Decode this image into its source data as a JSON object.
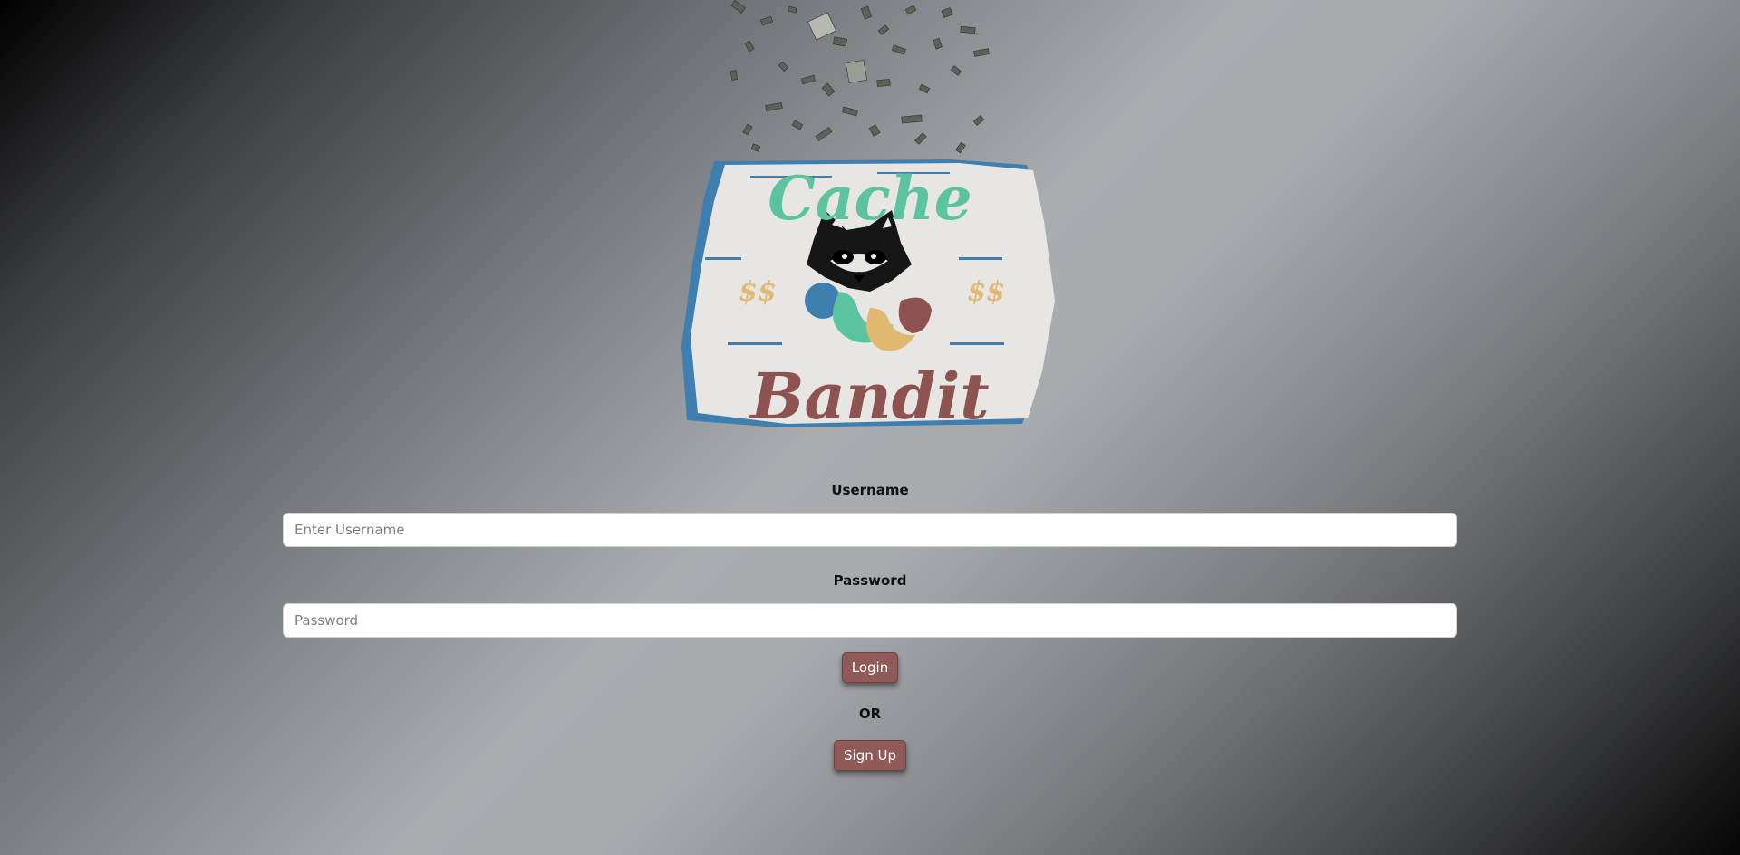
{
  "logo": {
    "word_top": "Cache",
    "word_bottom": "Bandit",
    "left_symbol": "$$",
    "right_symbol": "$$",
    "colors": {
      "teal": "#5cc3a0",
      "maroon": "#8c5350",
      "gold": "#e1b872",
      "blue": "#3f7fb0",
      "cream": "#e8e6e2"
    }
  },
  "form": {
    "username_label": "Username",
    "username_placeholder": "Enter Username",
    "password_label": "Password",
    "password_placeholder": "Password",
    "login_label": "Login",
    "or_label": "OR",
    "signup_label": "Sign Up"
  },
  "colors": {
    "button_bg": "#8f5a57",
    "button_text": "#ffffff"
  }
}
